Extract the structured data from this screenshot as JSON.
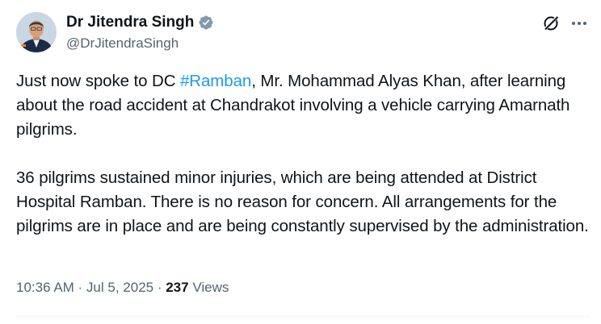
{
  "author": {
    "display_name": "Dr Jitendra Singh",
    "handle": "@DrJitendraSingh",
    "verified": true
  },
  "tweet": {
    "p1_before": "Just now spoke to DC ",
    "p1_hashtag": "#Ramban",
    "p1_after": ", Mr. Mohammad Alyas Khan, after learning about the road accident at Chandrakot involving a vehicle carrying Amarnath pilgrims.",
    "p2": "36 pilgrims sustained minor injuries, which are being attended at District Hospital Ramban. There is no reason for concern. All arrangements for the pilgrims are in place and are being constantly supervised by the administration."
  },
  "meta": {
    "time_date": "10:36 AM · Jul 5, 2025",
    "separator": " · ",
    "views_count": "237",
    "views_label": " Views"
  },
  "icons": {
    "verified": "verified-badge-icon",
    "grok": "grok-icon",
    "more": "more-options-icon"
  },
  "colors": {
    "text": "#0f1419",
    "secondary": "#536471",
    "link": "#1d9bf0",
    "verified_badge": "#829aab"
  }
}
